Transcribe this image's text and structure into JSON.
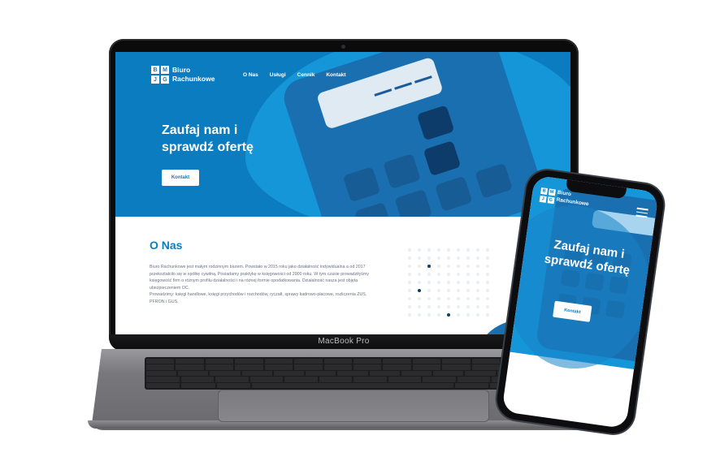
{
  "laptop": {
    "model_label": "MacBook Pro",
    "site": {
      "logo_letters": [
        "B",
        "M",
        "J",
        "G"
      ],
      "logo_line1": "Biuro",
      "logo_line2": "Rachunkowe",
      "nav": [
        "O Nas",
        "Usługi",
        "Cennik",
        "Kontakt"
      ],
      "hero_title": "Zaufaj nam i sprawdź ofertę",
      "hero_button": "Kontakt",
      "about_title": "O Nas",
      "about_paragraphs": [
        "Biuro Rachunkowe jest małym rodzinnym biurem. Powstało w 2015 roku jako działalność indywidualna a od 2017 przekształciło się w spółkę cywilną. Posiadamy praktykę w księgowości od 2000 roku. W tym czasie prowadziłyśmy księgowość firm o różnym profilu działalności i na różnej formie opodatkowania. Działalność nasza jest objęta ubezpieczeniem OC.",
        "Prowadzimy: księgi handlowe, księgi przychodów i rozchodów, ryczałt, sprawy kadrowo-płacowe, rozliczenia ZUS, PFRON i GUS."
      ]
    }
  },
  "phone": {
    "site": {
      "logo_letters": [
        "B",
        "M",
        "J",
        "G"
      ],
      "logo_line1": "Biuro",
      "logo_line2": "Rachunkowe",
      "hero_title": "Zaufaj nam i sprawdź ofertę",
      "hero_button": "Kontakt"
    }
  },
  "colors": {
    "brand_blue": "#0c7cc0",
    "light_blue": "#1596d8",
    "navy": "#0d3c6b"
  },
  "icons": {
    "phone_menu": "hamburger-menu-icon"
  }
}
